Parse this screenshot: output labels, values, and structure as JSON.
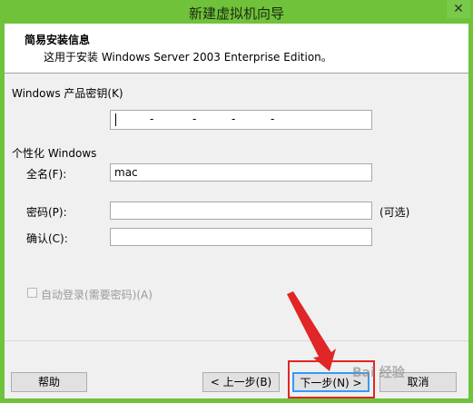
{
  "window": {
    "title": "新建虚拟机向导",
    "close_glyph": "✕"
  },
  "header": {
    "title": "简易安装信息",
    "subtitle": "这用于安装 Windows Server 2003 Enterprise Edition。"
  },
  "product_key": {
    "label": "Windows 产品密钥(K)",
    "separators": [
      "-",
      "-",
      "-",
      "-"
    ]
  },
  "personalize": {
    "section_label": "个性化 Windows",
    "fullname_label": "全名(F):",
    "fullname_value": "mac",
    "password_label": "密码(P):",
    "password_value": "",
    "optional_label": "(可选)",
    "confirm_label": "确认(C):",
    "confirm_value": ""
  },
  "autologon": {
    "label": "自动登录(需要密码)(A)",
    "checked": false,
    "enabled": false
  },
  "buttons": {
    "help": "帮助",
    "back": "< 上一步(B)",
    "next": "下一步(N) >",
    "cancel": "取消"
  },
  "watermark": "Bai 经验",
  "colors": {
    "title_bar": "#6fc23a",
    "highlight_box": "#e02626",
    "arrow": "#e02626",
    "default_button_border": "#3399ff"
  }
}
